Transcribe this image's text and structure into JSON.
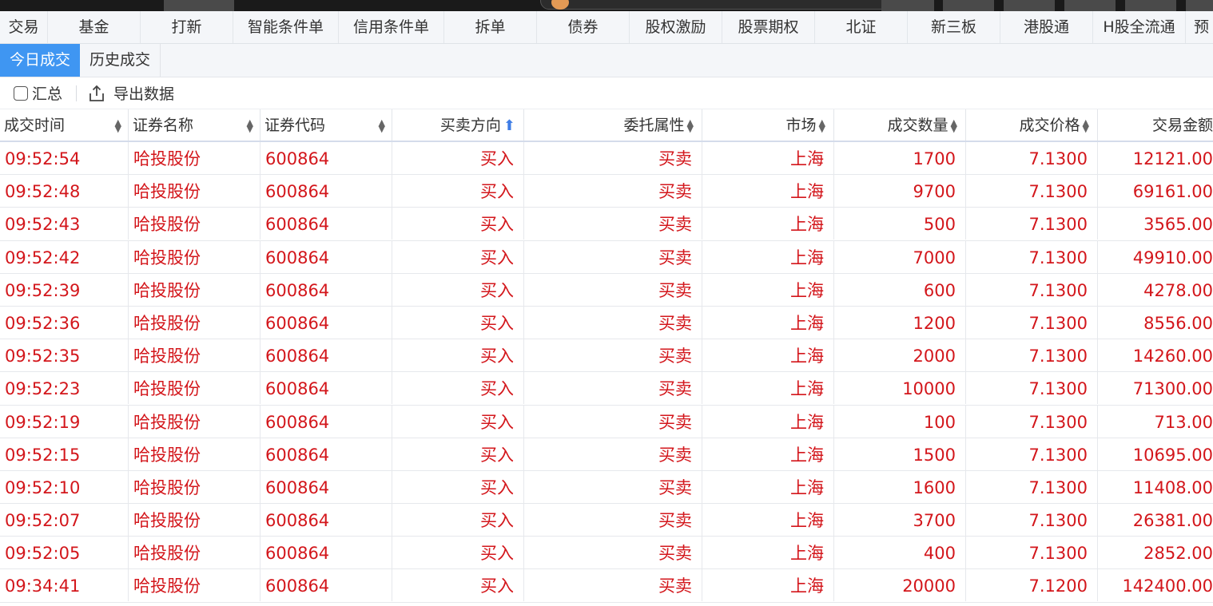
{
  "nav": {
    "items": [
      {
        "label": "交易",
        "w": 60
      },
      {
        "label": "基金",
        "w": 116
      },
      {
        "label": "打新",
        "w": 116
      },
      {
        "label": "智能条件单",
        "w": 132
      },
      {
        "label": "信用条件单",
        "w": 132
      },
      {
        "label": "拆单",
        "w": 116
      },
      {
        "label": "债券",
        "w": 116
      },
      {
        "label": "股权激励",
        "w": 116
      },
      {
        "label": "股票期权",
        "w": 116
      },
      {
        "label": "北证",
        "w": 116
      },
      {
        "label": "新三板",
        "w": 116
      },
      {
        "label": "港股通",
        "w": 116
      },
      {
        "label": "H股全流通",
        "w": 116
      },
      {
        "label": "预",
        "w": 40
      }
    ]
  },
  "subtabs": {
    "today": "今日成交",
    "history": "历史成交"
  },
  "toolbar": {
    "summary_label": "汇总",
    "export_label": "导出数据"
  },
  "table": {
    "headers": [
      "成交时间",
      "证券名称",
      "证券代码",
      "买卖方向",
      "委托属性",
      "市场",
      "成交数量",
      "成交价格",
      "交易金额"
    ],
    "rows": [
      [
        "09:52:54",
        "哈投股份",
        "600864",
        "买入",
        "买卖",
        "上海",
        "1700",
        "7.1300",
        "12121.00"
      ],
      [
        "09:52:48",
        "哈投股份",
        "600864",
        "买入",
        "买卖",
        "上海",
        "9700",
        "7.1300",
        "69161.00"
      ],
      [
        "09:52:43",
        "哈投股份",
        "600864",
        "买入",
        "买卖",
        "上海",
        "500",
        "7.1300",
        "3565.00"
      ],
      [
        "09:52:42",
        "哈投股份",
        "600864",
        "买入",
        "买卖",
        "上海",
        "7000",
        "7.1300",
        "49910.00"
      ],
      [
        "09:52:39",
        "哈投股份",
        "600864",
        "买入",
        "买卖",
        "上海",
        "600",
        "7.1300",
        "4278.00"
      ],
      [
        "09:52:36",
        "哈投股份",
        "600864",
        "买入",
        "买卖",
        "上海",
        "1200",
        "7.1300",
        "8556.00"
      ],
      [
        "09:52:35",
        "哈投股份",
        "600864",
        "买入",
        "买卖",
        "上海",
        "2000",
        "7.1300",
        "14260.00"
      ],
      [
        "09:52:23",
        "哈投股份",
        "600864",
        "买入",
        "买卖",
        "上海",
        "10000",
        "7.1300",
        "71300.00"
      ],
      [
        "09:52:19",
        "哈投股份",
        "600864",
        "买入",
        "买卖",
        "上海",
        "100",
        "7.1300",
        "713.00"
      ],
      [
        "09:52:15",
        "哈投股份",
        "600864",
        "买入",
        "买卖",
        "上海",
        "1500",
        "7.1300",
        "10695.00"
      ],
      [
        "09:52:10",
        "哈投股份",
        "600864",
        "买入",
        "买卖",
        "上海",
        "1600",
        "7.1300",
        "11408.00"
      ],
      [
        "09:52:07",
        "哈投股份",
        "600864",
        "买入",
        "买卖",
        "上海",
        "3700",
        "7.1300",
        "26381.00"
      ],
      [
        "09:52:05",
        "哈投股份",
        "600864",
        "买入",
        "买卖",
        "上海",
        "400",
        "7.1300",
        "2852.00"
      ],
      [
        "09:34:41",
        "哈投股份",
        "600864",
        "买入",
        "买卖",
        "上海",
        "20000",
        "7.1200",
        "142400.00"
      ]
    ]
  },
  "colors": {
    "accent": "#3f96f2",
    "trade_red": "#d3161b",
    "sort_active": "#3f7de6"
  }
}
